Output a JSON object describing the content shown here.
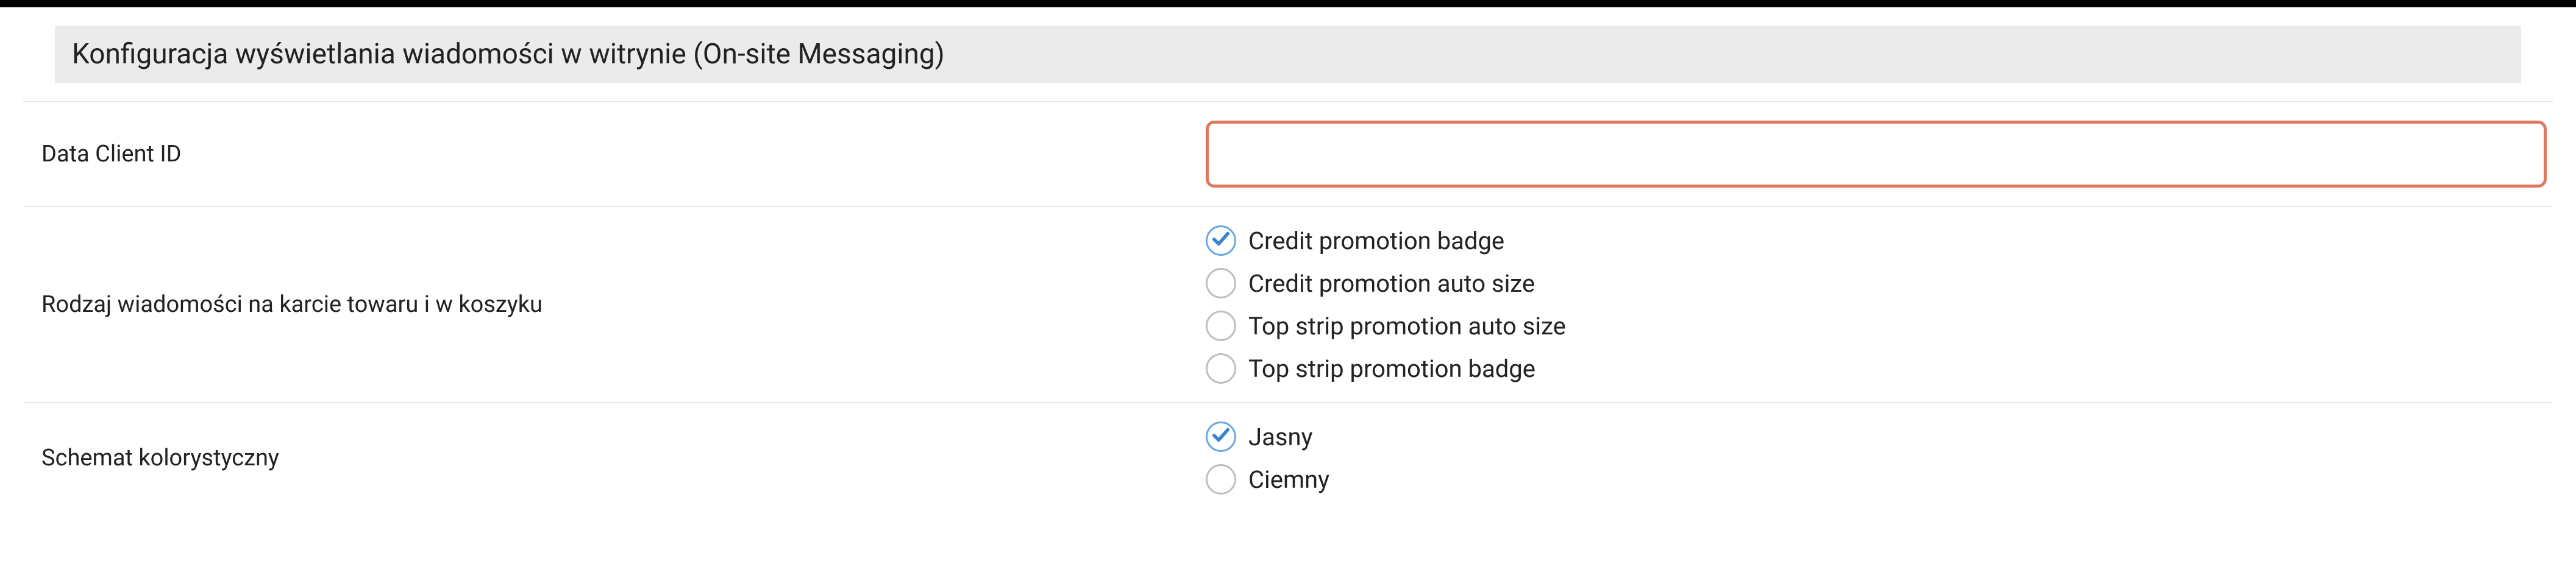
{
  "section": {
    "title": "Konfiguracja wyświetlania wiadomości w witrynie (On-site Messaging)"
  },
  "fields": {
    "data_client_id": {
      "label": "Data Client ID",
      "value": ""
    },
    "message_type": {
      "label": "Rodzaj wiadomości na karcie towaru i w koszyku",
      "options": [
        {
          "label": "Credit promotion badge",
          "checked": true
        },
        {
          "label": "Credit promotion auto size",
          "checked": false
        },
        {
          "label": "Top strip promotion auto size",
          "checked": false
        },
        {
          "label": "Top strip promotion badge",
          "checked": false
        }
      ]
    },
    "color_scheme": {
      "label": "Schemat kolorystyczny",
      "options": [
        {
          "label": "Jasny",
          "checked": true
        },
        {
          "label": "Ciemny",
          "checked": false
        }
      ]
    }
  }
}
